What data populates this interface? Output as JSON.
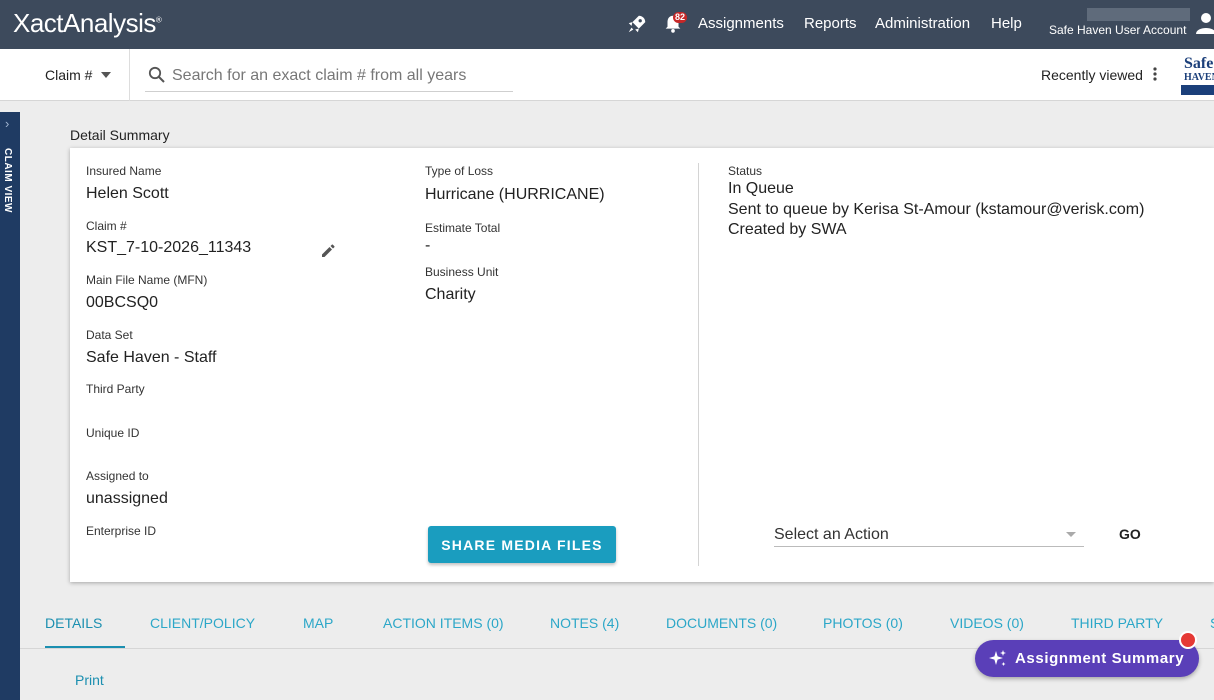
{
  "app": {
    "name": "XactAnalysis",
    "trademark": "®"
  },
  "topnav": {
    "notification_count": "82",
    "links": [
      "Assignments",
      "Reports",
      "Administration",
      "Help"
    ],
    "account_label": "Safe Haven User Account"
  },
  "searchbar": {
    "scope": "Claim #",
    "placeholder": "Search for an exact claim # from all years",
    "recently_viewed": "Recently viewed",
    "brand_logo_text": [
      "Safe",
      "HAVEN"
    ]
  },
  "siderail": {
    "label": "CLAIM VIEW"
  },
  "detail_summary": {
    "title": "Detail Summary",
    "left": [
      {
        "label": "Insured Name",
        "value": "Helen Scott"
      },
      {
        "label": "Claim #",
        "value": "KST_7-10-2026_11343"
      },
      {
        "label": "Main File Name (MFN)",
        "value": "00BCSQ0"
      },
      {
        "label": "Data Set",
        "value": "Safe Haven - Staff"
      },
      {
        "label": "Third Party",
        "value": ""
      },
      {
        "label": "Unique ID",
        "value": ""
      },
      {
        "label": "Assigned to",
        "value": "unassigned"
      },
      {
        "label": "Enterprise ID",
        "value": ""
      }
    ],
    "middle": [
      {
        "label": "Type of Loss",
        "value": "Hurricane (HURRICANE)"
      },
      {
        "label": "Estimate Total",
        "value": "-"
      },
      {
        "label": "Business Unit",
        "value": "Charity"
      }
    ],
    "status": {
      "label": "Status",
      "lines": [
        "In Queue",
        "Sent to queue by Kerisa St-Amour (kstamour@verisk.com)",
        "Created by SWA"
      ]
    },
    "share_button": "SHARE MEDIA FILES",
    "action_select": "Select an Action",
    "go_button": "GO"
  },
  "tabs": [
    "DETAILS",
    "CLIENT/POLICY",
    "MAP",
    "ACTION ITEMS (0)",
    "NOTES (4)",
    "DOCUMENTS (0)",
    "PHOTOS (0)",
    "VIDEOS (0)",
    "THIRD PARTY",
    "S"
  ],
  "active_tab": "DETAILS",
  "print_link": "Print",
  "assignment_summary_button": "Assignment Summary",
  "colors": {
    "topbar": "#3d4a5c",
    "accent": "#1a9dbf",
    "siderail": "#1f3b63",
    "summary_button": "#5a3fb8",
    "badge": "#c62828"
  }
}
